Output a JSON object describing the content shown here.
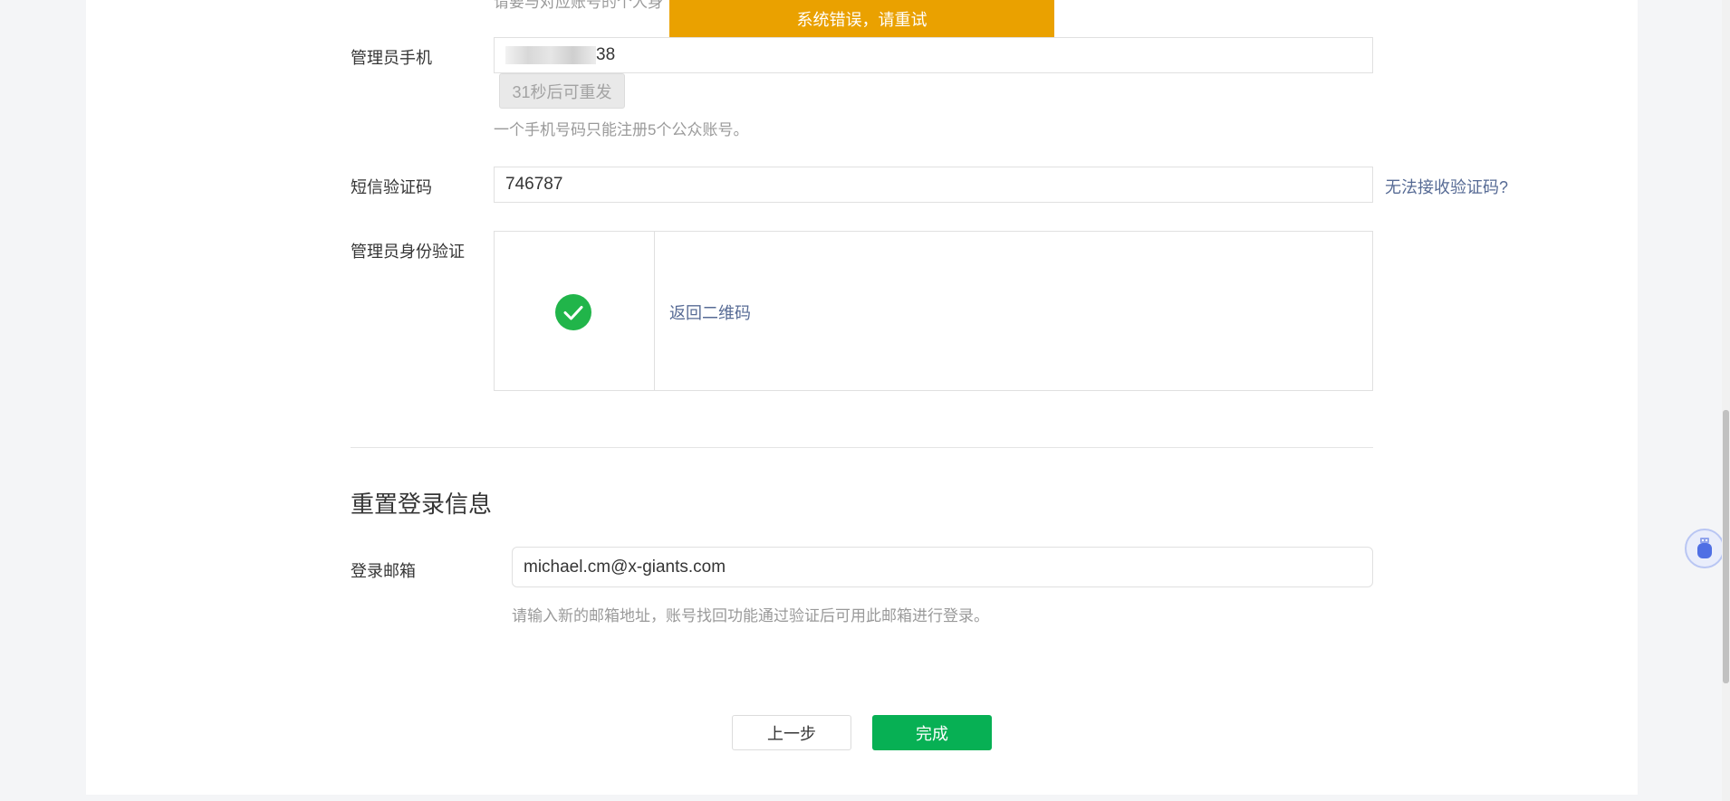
{
  "toast": {
    "message": "系统错误，请重试",
    "color": "#eaa100"
  },
  "top_hint_partial": "请要与对应账号的个人身",
  "admin_phone": {
    "label": "管理员手机",
    "value_visible_suffix": "38",
    "resend_button": "31秒后可重发",
    "hint": "一个手机号码只能注册5个公众账号。"
  },
  "sms_code": {
    "label": "短信验证码",
    "value": "746787",
    "cannot_receive_link": "无法接收验证码?"
  },
  "identity": {
    "label": "管理员身份验证",
    "status": "verified",
    "back_link": "返回二维码"
  },
  "reset_section": {
    "title": "重置登录信息",
    "email_label": "登录邮箱",
    "email_value": "michael.cm@x-giants.com",
    "email_hint": "请输入新的邮箱地址，账号找回功能通过验证后可用此邮箱进行登录。"
  },
  "footer": {
    "prev_button": "上一步",
    "finish_button": "完成",
    "primary_color": "#07b054"
  },
  "floating_widget": {
    "icon": "assistant-plugin-icon"
  }
}
